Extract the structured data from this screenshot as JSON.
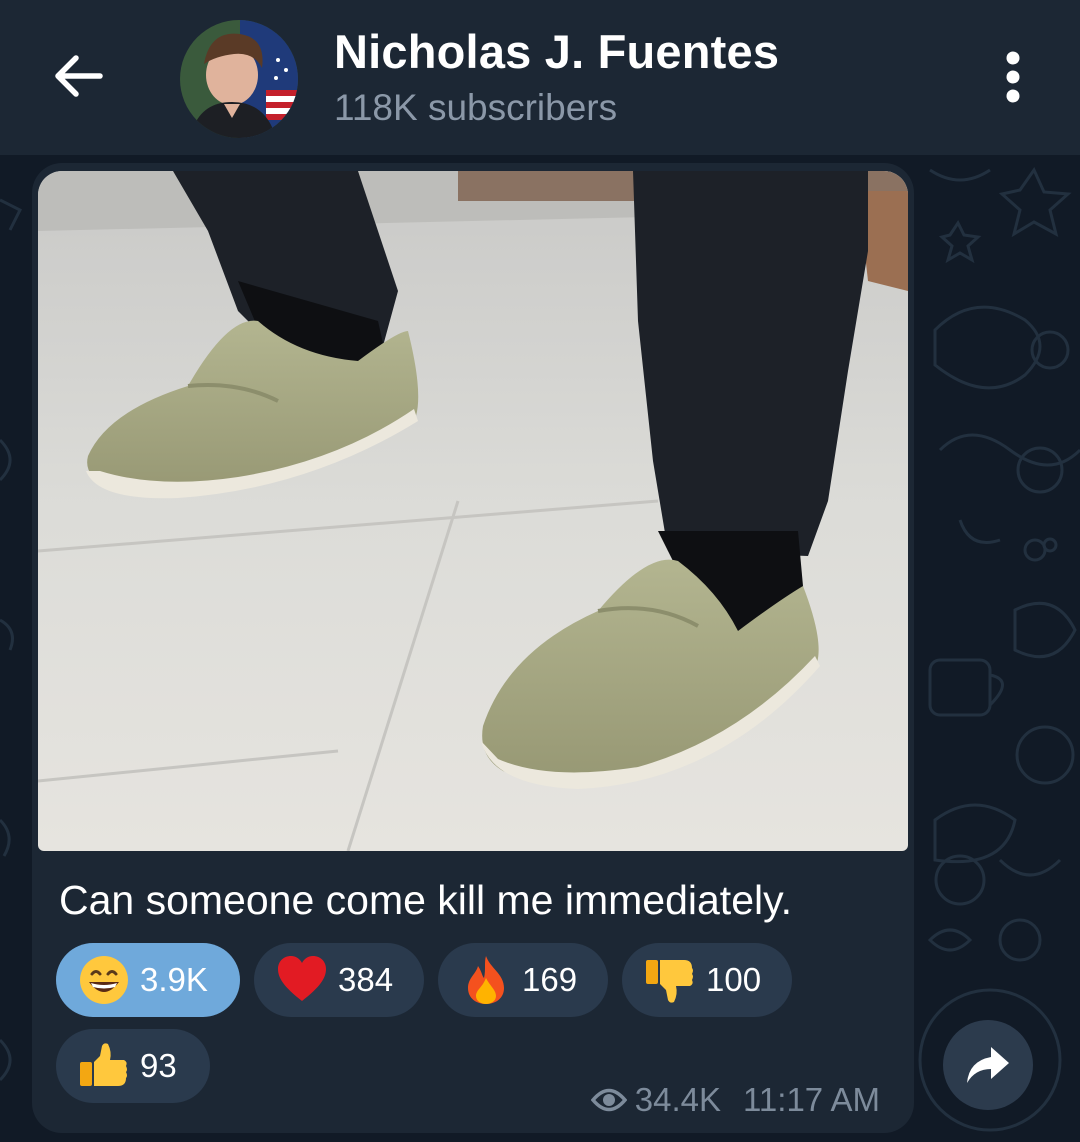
{
  "header": {
    "back_icon": "arrow-left-icon",
    "channel_name": "Nicholas J. Fuentes",
    "subscribers": "118K subscribers",
    "menu_icon": "more-vertical-icon"
  },
  "message": {
    "caption": "Can someone come kill me immediately.",
    "reactions": [
      {
        "emoji": "grinning-face",
        "count": "3.9K",
        "selected": true
      },
      {
        "emoji": "red-heart",
        "count": "384",
        "selected": false
      },
      {
        "emoji": "fire",
        "count": "169",
        "selected": false
      },
      {
        "emoji": "thumbs-down",
        "count": "100",
        "selected": false
      },
      {
        "emoji": "thumbs-up",
        "count": "93",
        "selected": false
      }
    ],
    "views_icon": "eye-icon",
    "views": "34.4K",
    "time": "11:17 AM"
  },
  "share_icon": "share-arrow-icon",
  "colors": {
    "background": "#111a26",
    "header": "#1c2734",
    "bubble": "#1c2734",
    "reaction": "#2a3a4d",
    "reaction_selected": "#6fa9db",
    "muted_text": "#8b98a8"
  }
}
